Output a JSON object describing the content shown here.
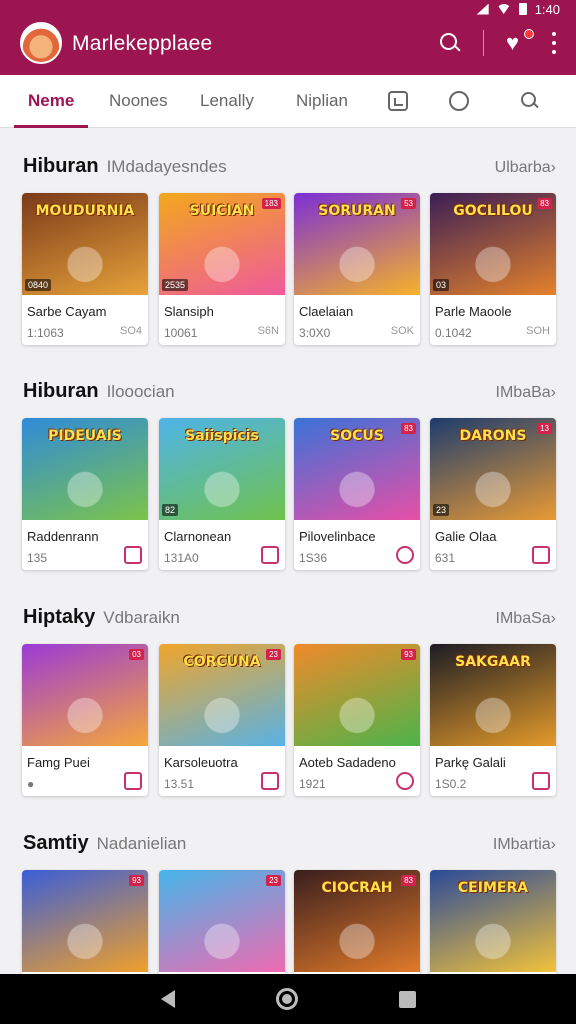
{
  "status": {
    "time": "1:40"
  },
  "appbar": {
    "title": "Marlekepplaee",
    "avatar": "fox-avatar",
    "icons": [
      "search-icon",
      "heart-icon",
      "more-vert-icon"
    ]
  },
  "tabs": [
    {
      "label": "Neme",
      "active": true
    },
    {
      "label": "Noones"
    },
    {
      "label": "Lenally"
    },
    {
      "label": "Niplian"
    }
  ],
  "tab_icons": [
    "image-box-icon",
    "circle-icon",
    "search-icon"
  ],
  "sections": [
    {
      "title": "Hiburan",
      "subtitle": "IMdadayesndes",
      "more": "Ulbarba›",
      "cards": [
        {
          "logo": "MOUDURNIA",
          "name": "Sarbe Cayam",
          "meta": "1:1063",
          "tag": "SO4",
          "badge_bl": "0840",
          "badge_tr": "",
          "colors": [
            "#7b3a1a",
            "#e7a23a"
          ]
        },
        {
          "logo": "SUICIAN",
          "name": "Slansiph",
          "meta": "10061",
          "tag": "S6N",
          "badge_bl": "2535",
          "badge_tr": "183",
          "colors": [
            "#f2a81c",
            "#ef5a9c"
          ]
        },
        {
          "logo": "SORURAN",
          "name": "Claelaian",
          "meta": "3:0X0",
          "tag": "SOK",
          "badge_bl": "",
          "badge_tr": "53",
          "colors": [
            "#7b2fd6",
            "#f5b22a"
          ]
        },
        {
          "logo": "GOCLILOU",
          "name": "Parle Maoole",
          "meta": "0.1042",
          "tag": "SOH",
          "badge_bl": "03",
          "badge_tr": "83",
          "colors": [
            "#3b1e56",
            "#e4822b"
          ]
        }
      ]
    },
    {
      "title": "Hiburan",
      "subtitle": "Ilooocian",
      "more": "IMbaBa›",
      "cards": [
        {
          "logo": "PIDEUAIS",
          "name": "Raddenrann",
          "meta": "135",
          "tag": "",
          "icon": "bag-icon",
          "badge_bl": "",
          "badge_tr": "",
          "colors": [
            "#2f8bd9",
            "#7cc44a"
          ]
        },
        {
          "logo": "Saiispicis",
          "name": "Clarnonean",
          "meta": "131A0",
          "tag": "",
          "icon": "share-icon",
          "badge_bl": "82",
          "badge_tr": "",
          "colors": [
            "#4fb3e8",
            "#6fc24d"
          ]
        },
        {
          "logo": "SOCUS",
          "name": "Pilovelinbace",
          "meta": "1S36",
          "tag": "",
          "icon": "chat-icon",
          "badge_bl": "",
          "badge_tr": "83",
          "colors": [
            "#3a72d8",
            "#e84fa7"
          ]
        },
        {
          "logo": "DARONS",
          "name": "Galie Olaa",
          "meta": "631",
          "tag": "",
          "icon": "tag-icon",
          "badge_bl": "23",
          "badge_tr": "13",
          "colors": [
            "#1d3c6e",
            "#e89a34"
          ]
        }
      ]
    },
    {
      "title": "Hiptaky",
      "subtitle": "Vdbaraikn",
      "more": "IMbaSa›",
      "cards": [
        {
          "logo": "",
          "name": "Famg Puei",
          "meta": "●",
          "tag": "",
          "icon": "ticket-icon",
          "badge_bl": "",
          "badge_tr": "03",
          "colors": [
            "#9b3ad6",
            "#f4a83a"
          ]
        },
        {
          "logo": "CORCUNA",
          "name": "Karsoleuotra",
          "meta": "13.51",
          "tag": "",
          "icon": "share-icon",
          "badge_bl": "",
          "badge_tr": "23",
          "colors": [
            "#f1a52a",
            "#57b2e6"
          ]
        },
        {
          "logo": "",
          "name": "Aoteb Sadadeno",
          "meta": "1921",
          "tag": "",
          "icon": "chat-icon",
          "badge_bl": "",
          "badge_tr": "93",
          "colors": [
            "#f08a2a",
            "#4cb44a"
          ]
        },
        {
          "logo": "SAKGAAR",
          "name": "Parkę Galali",
          "meta": "1S0.2",
          "tag": "",
          "icon": "tag-icon",
          "badge_bl": "",
          "badge_tr": "",
          "colors": [
            "#1c1c24",
            "#e49a2a"
          ]
        }
      ]
    },
    {
      "title": "Samtiy",
      "subtitle": "Nadanielian",
      "more": "IMbartia›",
      "cards": [
        {
          "logo": "",
          "name": "",
          "meta": "",
          "tag": "",
          "badge_bl": "",
          "badge_tr": "93",
          "colors": [
            "#3a5ed8",
            "#f0a02a"
          ]
        },
        {
          "logo": "",
          "name": "",
          "meta": "",
          "tag": "",
          "badge_bl": "",
          "badge_tr": "23",
          "colors": [
            "#46b6ea",
            "#ef6ab0"
          ]
        },
        {
          "logo": "CIOCRAH",
          "name": "",
          "meta": "",
          "tag": "",
          "badge_bl": "",
          "badge_tr": "83",
          "colors": [
            "#3a1e1e",
            "#e07a2a"
          ]
        },
        {
          "logo": "CEIMERA",
          "name": "",
          "meta": "",
          "tag": "",
          "badge_bl": "",
          "badge_tr": "",
          "colors": [
            "#2a4a9a",
            "#f2c23a"
          ]
        }
      ]
    }
  ],
  "navbar": {
    "icons": [
      "back-icon",
      "home-icon",
      "recents-icon"
    ]
  }
}
